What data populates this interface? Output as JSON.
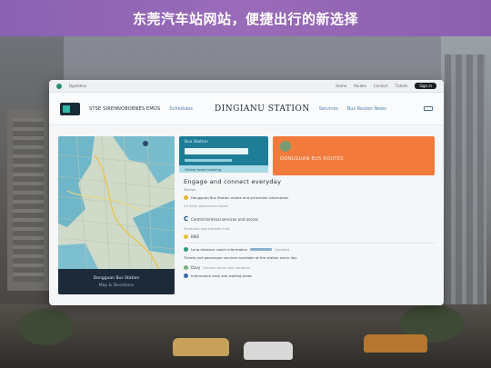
{
  "banner": {
    "title": "东莞汽车站网站，便捷出行的新选择"
  },
  "browser": {
    "topbar": {
      "brand": "Dgstation",
      "items": [
        "Home",
        "Routes",
        "Contact",
        "Tickets"
      ],
      "button_label": "Sign in"
    },
    "navbar": {
      "nav_text": "STSE SIRENNOBOBNES EMOS",
      "nav_link_1": "Schedules",
      "station_title": "DINGIANU STATION",
      "nav_link_2": "Services",
      "nav_link_3": "Bus Routes News"
    },
    "map": {
      "footer_title": "Dongguan Bus Station",
      "footer_sub": "Map & Directions"
    },
    "info_card": {
      "label": "Bus Station",
      "footer": "Online ticket booking"
    },
    "orange_card": {
      "text": "DONGGUAN BUS ROUTES"
    },
    "content": {
      "heading": "Engage and connect everyday",
      "sub": "Station",
      "row1": "Dongguan Bus Station routes and schedules information",
      "row1_tail": "All daily departures listed",
      "c_heading": "Central terminal services and access",
      "c_sub": "Schedule and transfer info",
      "badge": "BIKE",
      "row2": "Long distance coach information",
      "row2_tail": "Updated",
      "row3": "Tickets and passenger services available at the station every day",
      "d_heading": "Davy",
      "d_sub": "Service hours and contacts",
      "row4": "Information desk and waiting areas"
    },
    "colors": {
      "accent_teal": "#1e7e98",
      "accent_orange": "#f27a3c",
      "banner_purple": "#8a62b2"
    }
  }
}
